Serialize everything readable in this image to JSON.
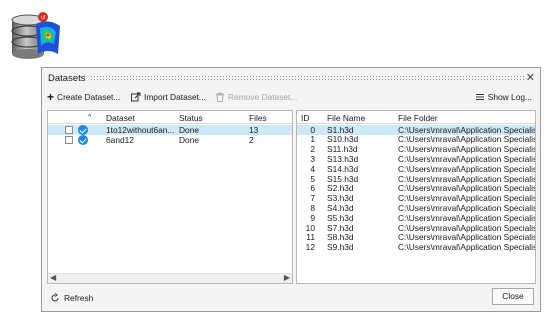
{
  "app_icon": "database-heatmap-icon",
  "dialog": {
    "title": "Datasets",
    "close_glyph": "✕",
    "toolbar": {
      "create": "Create Dataset...",
      "import": "Import Dataset...",
      "remove": "Remove Dataset...",
      "show_log": "Show Log..."
    },
    "left_table": {
      "columns": [
        "Dataset",
        "Status",
        "Files"
      ],
      "rows": [
        {
          "dataset": "1to12without6an...",
          "status": "Done",
          "files": "13",
          "selected": true
        },
        {
          "dataset": "6and12",
          "status": "Done",
          "files": "2",
          "selected": false
        }
      ]
    },
    "right_table": {
      "columns": [
        "ID",
        "File Name",
        "File Folder"
      ],
      "rows": [
        {
          "id": "0",
          "name": "S1.h3d",
          "folder": "C:\\Users\\mraval\\Application Specialis..."
        },
        {
          "id": "1",
          "name": "S10.h3d",
          "folder": "C:\\Users\\mraval\\Application Specialis..."
        },
        {
          "id": "2",
          "name": "S11.h3d",
          "folder": "C:\\Users\\mraval\\Application Specialis..."
        },
        {
          "id": "3",
          "name": "S13.h3d",
          "folder": "C:\\Users\\mraval\\Application Specialis..."
        },
        {
          "id": "4",
          "name": "S14.h3d",
          "folder": "C:\\Users\\mraval\\Application Specialis..."
        },
        {
          "id": "5",
          "name": "S15.h3d",
          "folder": "C:\\Users\\mraval\\Application Specialis..."
        },
        {
          "id": "6",
          "name": "S2.h3d",
          "folder": "C:\\Users\\mraval\\Application Specialis..."
        },
        {
          "id": "7",
          "name": "S3.h3d",
          "folder": "C:\\Users\\mraval\\Application Specialis..."
        },
        {
          "id": "8",
          "name": "S4.h3d",
          "folder": "C:\\Users\\mraval\\Application Specialis..."
        },
        {
          "id": "9",
          "name": "S5.h3d",
          "folder": "C:\\Users\\mraval\\Application Specialis..."
        },
        {
          "id": "10",
          "name": "S7.h3d",
          "folder": "C:\\Users\\mraval\\Application Specialis..."
        },
        {
          "id": "11",
          "name": "S8.h3d",
          "folder": "C:\\Users\\mraval\\Application Specialis..."
        },
        {
          "id": "12",
          "name": "S9.h3d",
          "folder": "C:\\Users\\mraval\\Application Specialis..."
        }
      ]
    },
    "footer": {
      "refresh": "Refresh",
      "close": "Close"
    }
  },
  "colors": {
    "selection": "#cde8f7",
    "check_badge": "#1e88e5"
  }
}
